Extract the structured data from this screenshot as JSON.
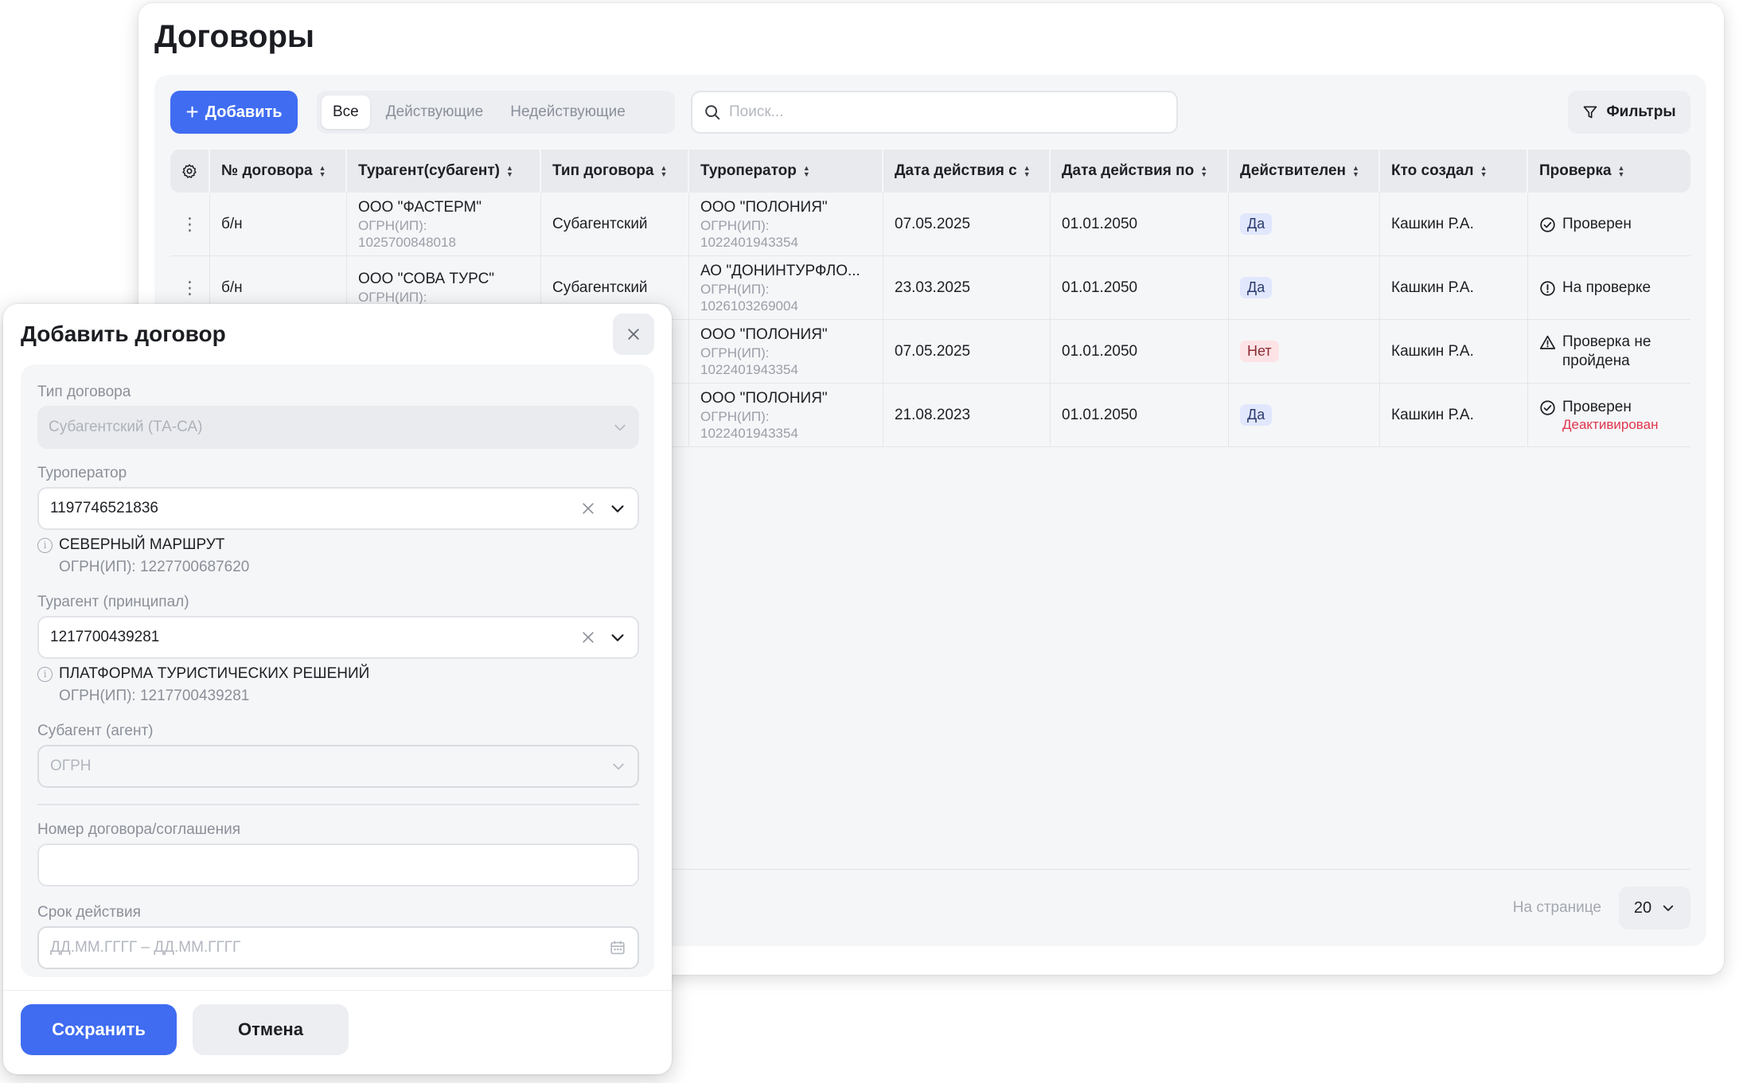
{
  "page": {
    "title": "Договоры",
    "add_label": "Добавить",
    "tabs": [
      {
        "label": "Все",
        "active": true
      },
      {
        "label": "Действующие",
        "active": false
      },
      {
        "label": "Недействующие",
        "active": false
      }
    ],
    "search_placeholder": "Поиск...",
    "filters_label": "Фильтры"
  },
  "table": {
    "columns": [
      "№ договора",
      "Турагент(субагент)",
      "Тип договора",
      "Туроператор",
      "Дата действия с",
      "Дата действия по",
      "Действителен",
      "Кто создал",
      "Проверка"
    ],
    "rows": [
      {
        "number": "б/н",
        "agent_name": "ООО \"ФАСТЕРМ\"",
        "agent_ogrn_label": "ОГРН(ИП):",
        "agent_ogrn": "1025700848018",
        "type": "Субагентский",
        "operator_name": "ООО \"ПОЛОНИЯ\"",
        "operator_ogrn_label": "ОГРН(ИП):",
        "operator_ogrn": "1022401943354",
        "date_from": "07.05.2025",
        "date_to": "01.01.2050",
        "valid": "Да",
        "valid_state": "yes",
        "creator": "Кашкин Р.А.",
        "check": "Проверен",
        "check_icon": "check-circle-icon",
        "check_extra": ""
      },
      {
        "number": "б/н",
        "agent_name": "ООО \"СОВА ТУРС\"",
        "agent_ogrn_label": "ОГРН(ИП):",
        "agent_ogrn": "",
        "type": "Субагентский",
        "operator_name": "АО \"ДОНИНТУРФЛО...",
        "operator_ogrn_label": "ОГРН(ИП):",
        "operator_ogrn": "1026103269004",
        "date_from": "23.03.2025",
        "date_to": "01.01.2050",
        "valid": "Да",
        "valid_state": "yes",
        "creator": "Кашкин Р.А.",
        "check": "На проверке",
        "check_icon": "exclamation-circle-icon",
        "check_extra": ""
      },
      {
        "number": "",
        "agent_name": "",
        "agent_ogrn_label": "",
        "agent_ogrn": "",
        "type": "",
        "operator_name": "ООО \"ПОЛОНИЯ\"",
        "operator_ogrn_label": "ОГРН(ИП):",
        "operator_ogrn": "1022401943354",
        "date_from": "07.05.2025",
        "date_to": "01.01.2050",
        "valid": "Нет",
        "valid_state": "no",
        "creator": "Кашкин Р.А.",
        "check": "Проверка не пройдена",
        "check_icon": "warning-triangle-icon",
        "check_extra": ""
      },
      {
        "number": "",
        "agent_name": "",
        "agent_ogrn_label": "",
        "agent_ogrn": "",
        "type": "",
        "operator_name": "ООО \"ПОЛОНИЯ\"",
        "operator_ogrn_label": "ОГРН(ИП):",
        "operator_ogrn": "1022401943354",
        "date_from": "21.08.2023",
        "date_to": "01.01.2050",
        "valid": "Да",
        "valid_state": "yes",
        "creator": "Кашкин Р.А.",
        "check": "Проверен",
        "check_icon": "check-circle-icon",
        "check_extra": "Деактивирован"
      }
    ]
  },
  "pager": {
    "label": "На странице",
    "value": "20"
  },
  "modal": {
    "title": "Добавить договор",
    "contract_type_label": "Тип договора",
    "contract_type_value": "Субагентский (ТА-СА)",
    "operator_label": "Туроператор",
    "operator_value": "1197746521836",
    "operator_hint_name": "СЕВЕРНЫЙ МАРШРУТ",
    "operator_hint_ogrn": "ОГРН(ИП): 1227700687620",
    "agent_label": "Турагент (принципал)",
    "agent_value": "1217700439281",
    "agent_hint_name": "ПЛАТФОРМА ТУРИСТИЧЕСКИХ РЕШЕНИЙ",
    "agent_hint_ogrn": "ОГРН(ИП): 1217700439281",
    "subagent_label": "Субагент (агент)",
    "subagent_placeholder": "ОГРН",
    "number_label": "Номер договора/соглашения",
    "number_value": "",
    "period_label": "Срок действия",
    "period_placeholder": "ДД.ММ.ГГГГ – ДД.ММ.ГГГГ",
    "save_label": "Сохранить",
    "cancel_label": "Отмена"
  },
  "colors": {
    "accent": "#3f6cf1",
    "danger": "#e0354c",
    "badge_yes": "#e1e7fd",
    "badge_no": "#fde3e5"
  }
}
